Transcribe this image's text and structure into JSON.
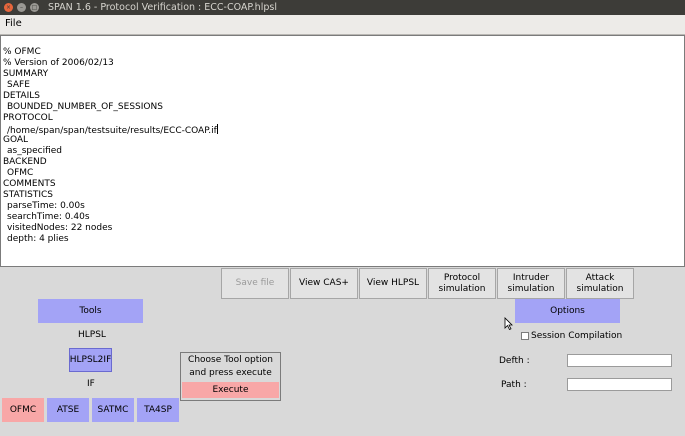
{
  "window": {
    "title": "SPAN 1.6 - Protocol Verification : ECC-COAP.hlpsl",
    "close_glyph": "×",
    "minimize_glyph": "–",
    "maximize_glyph": "□"
  },
  "menu": {
    "file": "File"
  },
  "output_lines": [
    "% OFMC",
    "% Version of 2006/02/13",
    "SUMMARY",
    "  SAFE",
    "DETAILS",
    "  BOUNDED_NUMBER_OF_SESSIONS",
    "PROTOCOL",
    "  /home/span/span/testsuite/results/ECC-COAP.if",
    "GOAL",
    "  as_specified",
    "BACKEND",
    "  OFMC",
    "COMMENTS",
    "STATISTICS",
    "  parseTime: 0.00s",
    "  searchTime: 0.40s",
    "  visitedNodes: 22 nodes",
    "  depth: 4 plies"
  ],
  "toolbar": {
    "save_file": "Save file",
    "view_cas": "View CAS+",
    "view_hlpsl": "View HLPSL",
    "protocol_simulation": "Protocol\nsimulation",
    "intruder_simulation": "Intruder\nsimulation",
    "attack_simulation": "Attack\nsimulation"
  },
  "tools": {
    "header": "Tools",
    "hlpsl_label": "HLPSL",
    "hlpsl2if": "HLPSL2IF",
    "if_label": "IF",
    "backends": [
      "OFMC",
      "ATSE",
      "SATMC",
      "TA4SP"
    ],
    "selected_backend": "OFMC"
  },
  "execute_panel": {
    "instruction": "Choose Tool option and press execute",
    "execute": "Execute"
  },
  "options": {
    "header": "Options",
    "session_compilation_label": "Session Compilation",
    "session_compilation_checked": false,
    "depth_label": "Defth :",
    "depth_value": "",
    "path_label": "Path :",
    "path_value": ""
  },
  "colors": {
    "accent_purple": "#a3a3f6",
    "selected_pink": "#f8a7a7",
    "titlebar": "#3d3c38",
    "close_button": "#e8663c"
  }
}
